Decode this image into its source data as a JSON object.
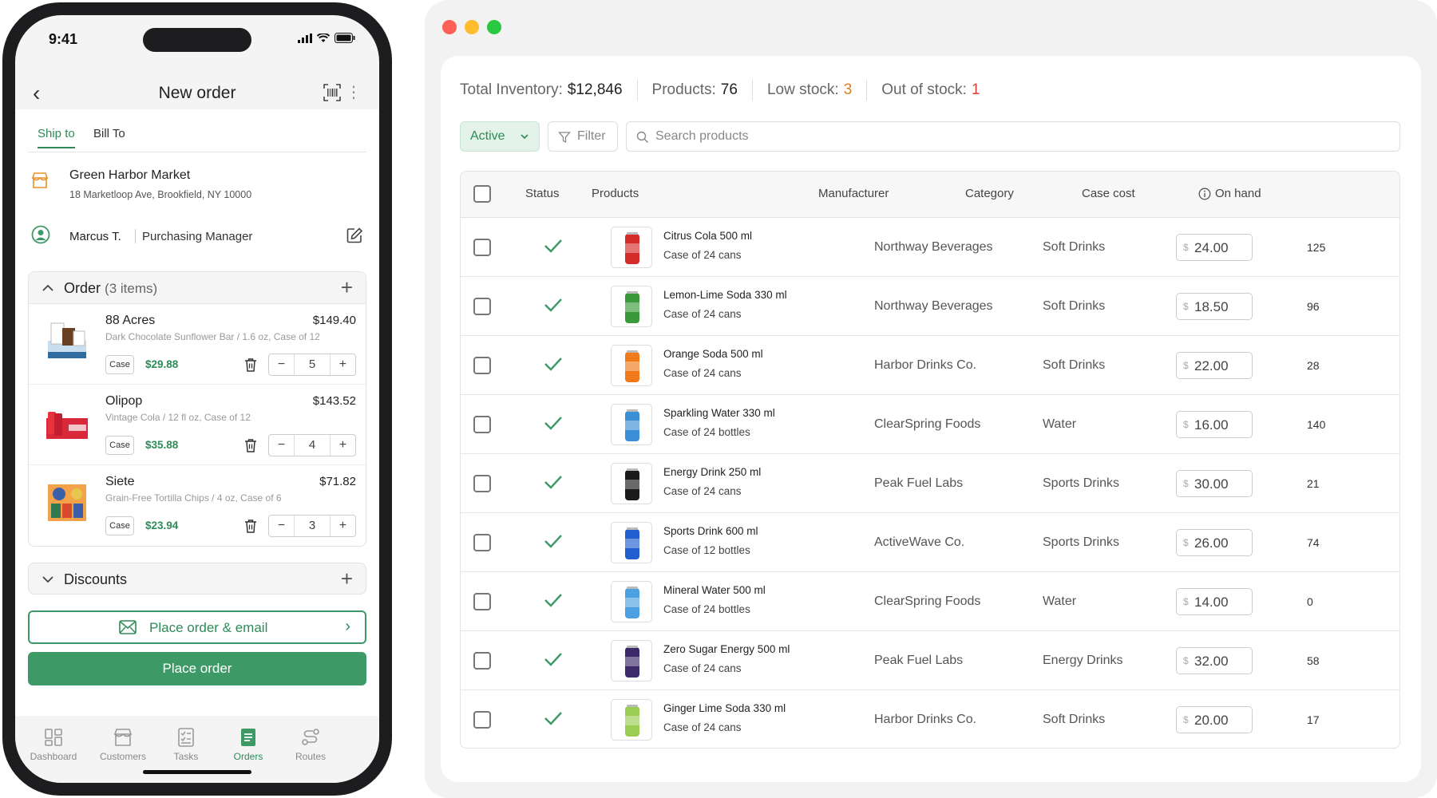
{
  "phone": {
    "status_time": "9:41",
    "title": "New order",
    "tabs": [
      "Ship to",
      "Bill To"
    ],
    "ship_to": {
      "name": "Green Harbor Market",
      "address": "18 Marketloop Ave, Brookfield, NY 10000"
    },
    "contact": {
      "name": "Marcus T.",
      "role": "Purchasing Manager"
    },
    "order": {
      "label": "Order",
      "count": "(3 items)",
      "items": [
        {
          "name": "88 Acres",
          "price": "$149.40",
          "desc": "Dark Chocolate Sunflower Bar / 1.6 oz, Case of 12",
          "unit_label": "Case",
          "unit_price": "$29.88",
          "qty": "5"
        },
        {
          "name": "Olipop",
          "price": "$143.52",
          "desc": "Vintage Cola / 12 fl oz, Case of 12",
          "unit_label": "Case",
          "unit_price": "$35.88",
          "qty": "4"
        },
        {
          "name": "Siete",
          "price": "$71.82",
          "desc": "Grain-Free Tortilla Chips / 4 oz, Case of 6",
          "unit_label": "Case",
          "unit_price": "$23.94",
          "qty": "3"
        }
      ]
    },
    "discounts_label": "Discounts",
    "place_email_label": "Place order & email",
    "place_label": "Place order",
    "tabbar": [
      {
        "label": "Dashboard",
        "active": false
      },
      {
        "label": "Customers",
        "active": false
      },
      {
        "label": "Tasks",
        "active": false
      },
      {
        "label": "Orders",
        "active": true
      },
      {
        "label": "Routes",
        "active": false
      }
    ],
    "accent": "#3d9a66"
  },
  "inventory": {
    "stats": {
      "total_label": "Total Inventory:",
      "total_value": "$12,846",
      "products_label": "Products:",
      "products_value": "76",
      "low_label": "Low stock:",
      "low_value": "3",
      "out_label": "Out of stock:",
      "out_value": "1"
    },
    "filter_active": "Active",
    "filter_label": "Filter",
    "search_placeholder": "Search products",
    "columns": [
      "Status",
      "Products",
      "Manufacturer",
      "Category",
      "Case cost",
      "On hand"
    ],
    "currency_symbol": "$",
    "rows": [
      {
        "name": "Citrus Cola 500 ml",
        "pack": "Case of 24 cans",
        "manufacturer": "Northway Beverages",
        "category": "Soft Drinks",
        "cost": "24.00",
        "on_hand": "125",
        "color": "#d42b2b"
      },
      {
        "name": "Lemon-Lime Soda 330 ml",
        "pack": "Case of 24 cans",
        "manufacturer": "Northway Beverages",
        "category": "Soft Drinks",
        "cost": "18.50",
        "on_hand": "96",
        "color": "#3a9a3a"
      },
      {
        "name": "Orange Soda 500 ml",
        "pack": "Case of 24 cans",
        "manufacturer": "Harbor Drinks Co.",
        "category": "Soft Drinks",
        "cost": "22.00",
        "on_hand": "28",
        "color": "#f07a1a"
      },
      {
        "name": "Sparkling Water 330 ml",
        "pack": "Case of 24 bottles",
        "manufacturer": "ClearSpring Foods",
        "category": "Water",
        "cost": "16.00",
        "on_hand": "140",
        "color": "#3b8fd6"
      },
      {
        "name": "Energy Drink 250 ml",
        "pack": "Case of 24 cans",
        "manufacturer": "Peak Fuel Labs",
        "category": "Sports Drinks",
        "cost": "30.00",
        "on_hand": "21",
        "color": "#1a1a1a"
      },
      {
        "name": "Sports Drink 600 ml",
        "pack": "Case of 12 bottles",
        "manufacturer": "ActiveWave Co.",
        "category": "Sports Drinks",
        "cost": "26.00",
        "on_hand": "74",
        "color": "#1f5fd0"
      },
      {
        "name": "Mineral Water 500 ml",
        "pack": "Case of 24 bottles",
        "manufacturer": "ClearSpring Foods",
        "category": "Water",
        "cost": "14.00",
        "on_hand": "0",
        "color": "#4aa0e0"
      },
      {
        "name": "Zero Sugar Energy 500 ml",
        "pack": "Case of 24 cans",
        "manufacturer": "Peak Fuel Labs",
        "category": "Energy Drinks",
        "cost": "32.00",
        "on_hand": "58",
        "color": "#3a2a6a"
      },
      {
        "name": "Ginger Lime Soda 330 ml",
        "pack": "Case of 24 cans",
        "manufacturer": "Harbor Drinks Co.",
        "category": "Soft Drinks",
        "cost": "20.00",
        "on_hand": "17",
        "color": "#9acd52"
      }
    ]
  }
}
